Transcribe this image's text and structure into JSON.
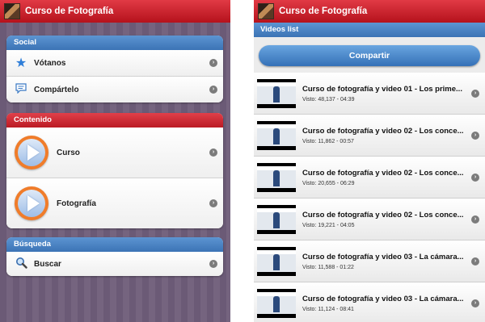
{
  "app_title": "Curso de Fotografía",
  "left": {
    "social": {
      "header": "Social",
      "items": [
        {
          "label": "Vótanos",
          "icon": "star-icon"
        },
        {
          "label": "Compártelo",
          "icon": "speech-bubble-icon"
        }
      ]
    },
    "contenido": {
      "header": "Contenido",
      "items": [
        {
          "label": "Curso",
          "icon": "play-icon"
        },
        {
          "label": "Fotografía",
          "icon": "play-icon"
        }
      ]
    },
    "busqueda": {
      "header": "Búsqueda",
      "items": [
        {
          "label": "Buscar",
          "icon": "magnifier-icon"
        }
      ]
    }
  },
  "right": {
    "list_header": "Videos list",
    "share_label": "Compartir",
    "videos": [
      {
        "title": "Curso de fotografía y video 01 - Los prime...",
        "meta": "Visto: 48,137 - 04:39"
      },
      {
        "title": "Curso de fotografía y video 02 - Los conce...",
        "meta": "Visto: 11,862 - 00:57"
      },
      {
        "title": "Curso de fotografía y video 02 - Los conce...",
        "meta": "Visto: 20,655 - 06:29"
      },
      {
        "title": "Curso de fotografía y video 02 - Los conce...",
        "meta": "Visto: 19,221 - 04:05"
      },
      {
        "title": "Curso de fotografía y video 03 - La cámara...",
        "meta": "Visto: 11,588 - 01:22"
      },
      {
        "title": "Curso de fotografía y video 03 - La cámara...",
        "meta": "Visto: 11,124 - 08:41"
      }
    ]
  }
}
